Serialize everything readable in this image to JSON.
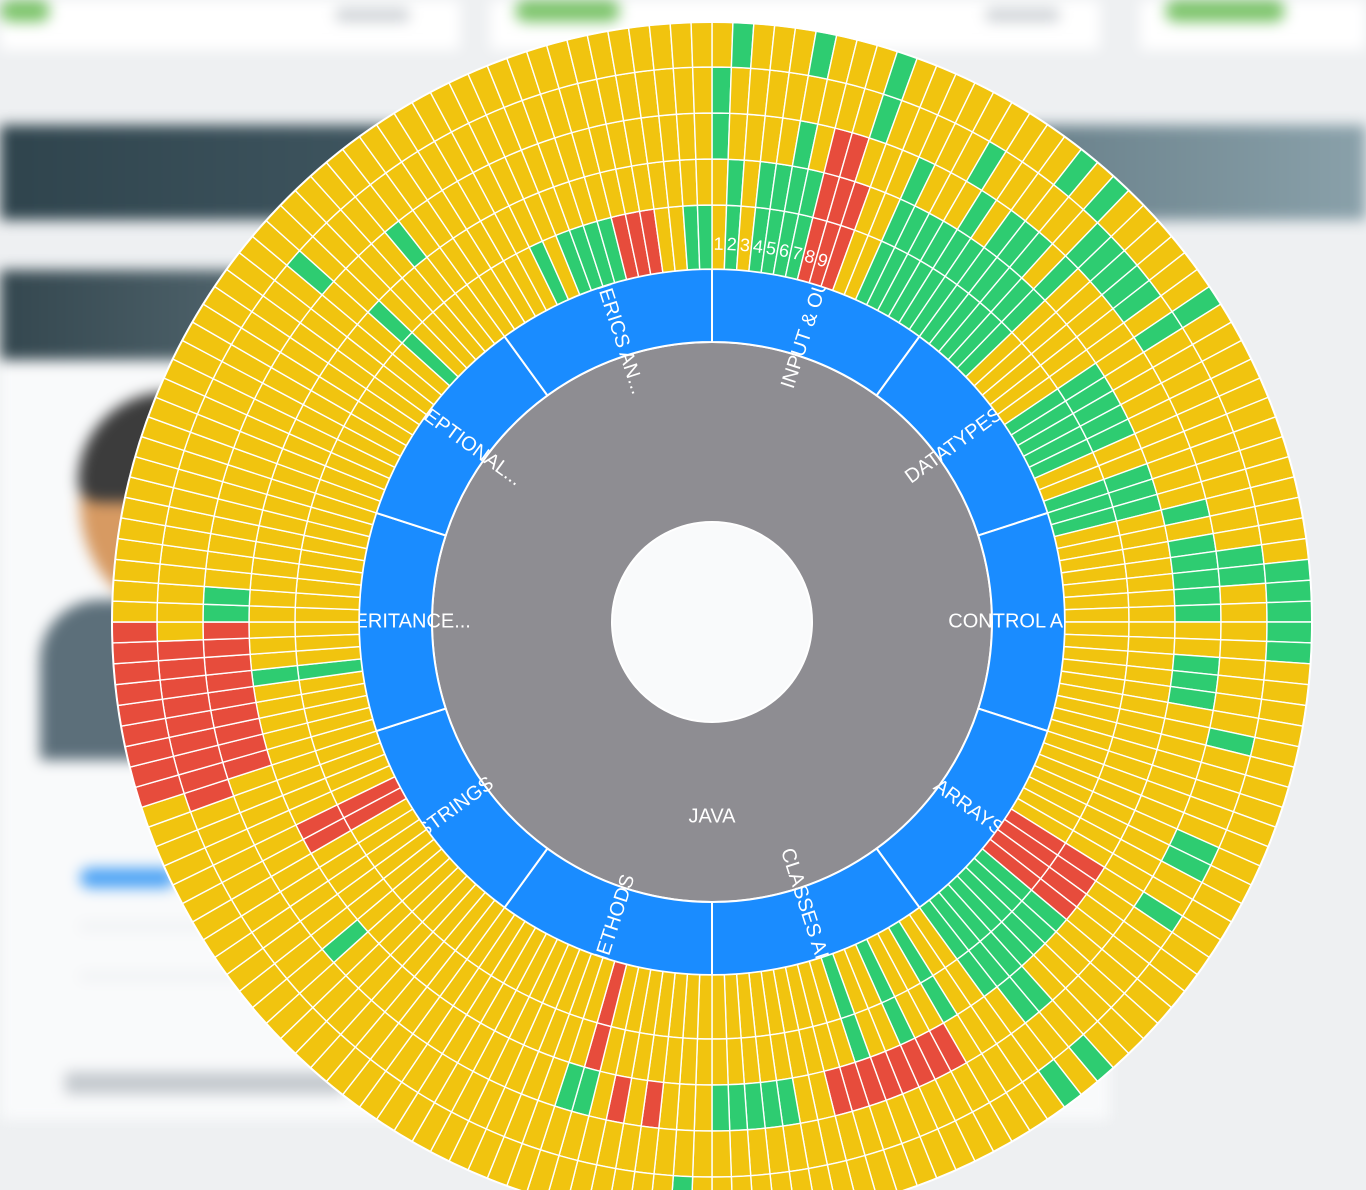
{
  "chart_data": {
    "type": "sunburst",
    "root": {
      "label": "JAVA",
      "color": "#8e8d92"
    },
    "topics": [
      {
        "label": "INPUT & OUT..."
      },
      {
        "label": "DATATYPES A..."
      },
      {
        "label": "CONTROL AND..."
      },
      {
        "label": "ARRAYS"
      },
      {
        "label": "CLASSES AND..."
      },
      {
        "label": "METHODS"
      },
      {
        "label": "STRINGS"
      },
      {
        "label": "INHERITANCE..."
      },
      {
        "label": "EXCEPTIONAL..."
      },
      {
        "label": "GENERICS AN..."
      }
    ],
    "ring1_numbers": [
      "1",
      "2",
      "3",
      "4",
      "5",
      "6",
      "7",
      "8",
      "9"
    ],
    "status_colors": {
      "G": "#2ecc71",
      "Y": "#f1c40f",
      "R": "#e74c3c"
    },
    "topic_color": "#1a8cff",
    "rings": [
      "YGYGGGGRRRYYGGGGGGGGGGGYYYYYGGGGGYYGGGYYYYYYYYYYYYYYYYYYYYYYYRRRRGGGGGGGYYGYYGYYGYYYYYYYYYYYYYYYYRYYYYYYYYYYYYYYYYYYYYYYRRYYYYYYYYYGYYYYYYYYYYYYYYYYYYYYYYYYGYYYYYYYYY",
      "GYYYYGYRRYYYGYYYGYGGGYGYYYYYYYYYYYYYYYGYGGGGGYYGGGYYYYYYYYYYYYYYYYYYYGGYYYYRRRRRRRRYYGGGGGYYYRYRYGGYYYYYYYYYYYYYYYGYYYYYYYYYYYRRRRRRRRRGGYYYYYYYYYYYYYYYYYYYYYYYGYY",
      "GYYYYYYYYGYYYYYGYYYYYYGGGGGYGYYYYYYYYYYYYGGYYYYYYYYGYYYYYGGYYGYYYYYYYYYYYYYYYYYYYYYYYYYYYYYYYYYYYYYYYYYYYYYYYYYYYYYYYYYYYYYYYRRRRRRRRRYYYYYYYYYYYYYYYYYYYYYGYYYYYYYYY",
      "YGYYYGYYYGYYYYYYYYYGYGYYYYYYGYYYYYYYYYYYYYGGGGGYYYYYYYYYYYYYYYYYYYYYYGYGYYYYYYYYYYYYYYYYYYYGYYYYYYYYYYYYYYYYYYYYYYYYYYYYYYYYYYRRRRRRRRRYYYYYYYYYYYYYYYYYYYYYYYYYYYYYYY"
    ]
  }
}
